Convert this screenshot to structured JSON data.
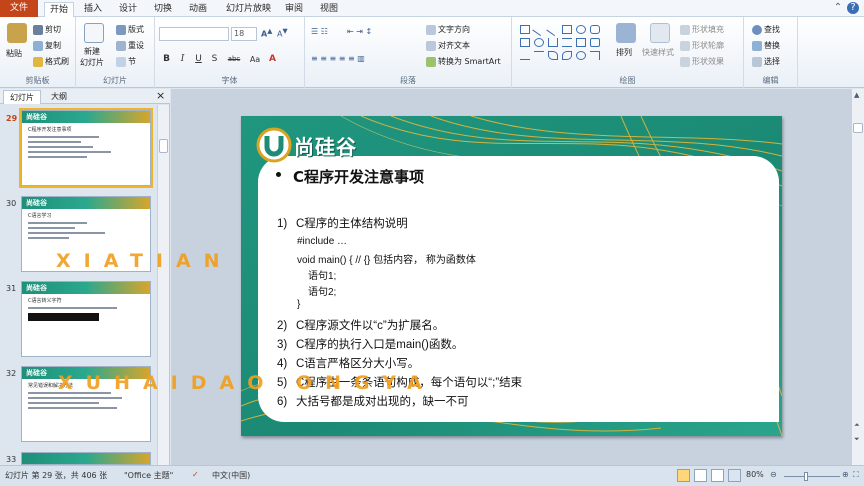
{
  "tabs": {
    "file": "文件",
    "items": [
      "开始",
      "插入",
      "设计",
      "切换",
      "动画",
      "幻灯片放映",
      "审阅",
      "视图"
    ],
    "active": "开始"
  },
  "ribbon": {
    "clipboard": {
      "paste": "粘贴",
      "cut": "剪切",
      "copy": "复制",
      "format_painter": "格式刷",
      "label": "剪贴板"
    },
    "slides": {
      "new_slide": "新建",
      "new_slide2": "幻灯片",
      "layout": "版式",
      "reset": "重设",
      "section": "节",
      "label": "幻灯片"
    },
    "font": {
      "size": "18",
      "label": "字体",
      "bold": "B",
      "italic": "I",
      "underline": "U",
      "strike": "S",
      "abc": "abc",
      "aa": "Aa"
    },
    "paragraph": {
      "text_direction": "文字方向",
      "align_text": "对齐文本",
      "smartart": "转换为 SmartArt",
      "label": "段落"
    },
    "drawing": {
      "arrange": "排列",
      "quick_styles": "快速样式",
      "shape_fill": "形状填充",
      "shape_outline": "形状轮廓",
      "shape_effects": "形状效果",
      "label": "绘图"
    },
    "editing": {
      "find": "查找",
      "replace": "替换",
      "select": "选择",
      "label": "编辑"
    }
  },
  "panel": {
    "tab_slides": "幻灯片",
    "tab_outline": "大纲",
    "close": "×",
    "thumbs": [
      {
        "num": "29",
        "title": "C程序开发注意事项",
        "selected": true
      },
      {
        "num": "30",
        "title": "C语言学习",
        "selected": false
      },
      {
        "num": "31",
        "title": "C语言转义字符",
        "selected": false
      },
      {
        "num": "32",
        "title": "常见错误和解决方法",
        "selected": false
      },
      {
        "num": "33",
        "title": "",
        "selected": false
      }
    ]
  },
  "slide": {
    "logo_text": "尚硅谷",
    "title": "C程序开发注意事项",
    "items": [
      {
        "num": "1)",
        "text": "C程序的主体结构说明"
      },
      {
        "num": "2)",
        "text": "C程序源文件以“c”为扩展名。"
      },
      {
        "num": "3)",
        "text": "C程序的执行入口是main()函数。"
      },
      {
        "num": "4)",
        "text": "C语言严格区分大小写。"
      },
      {
        "num": "5)",
        "text": "C程序由一条条语句构成，每个语句以“;”结束"
      },
      {
        "num": "6)",
        "text": "大括号都是成对出现的，缺一不可"
      }
    ],
    "code": [
      "#include …",
      "void   main() { // {}  包括内容，  称为函数体",
      "语句1;",
      "语句2;",
      "}"
    ]
  },
  "watermarks": [
    "XIATIAN",
    "XUHAIDAO  ONGYA"
  ],
  "status": {
    "slide_info": "幻灯片 第 29 张，共 406 张",
    "theme": "\"Office 主题\"",
    "language": "中文(中国)",
    "zoom": "80%",
    "zoom_level": 0.8
  },
  "colors": {
    "file_tab": "#c4451a",
    "accent": "#f0b429",
    "slide_teal": "#1f8f7a",
    "watermark": "#f0a020"
  }
}
